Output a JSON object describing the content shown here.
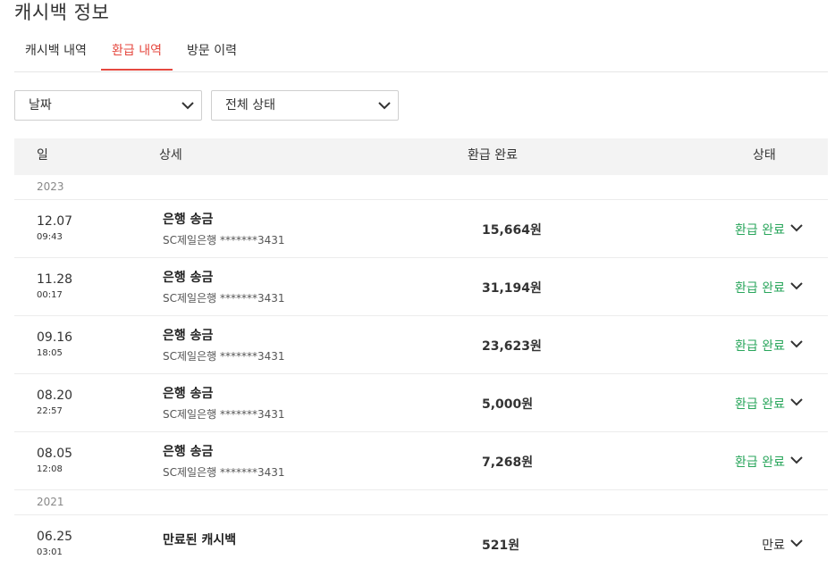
{
  "page_title": "캐시백 정보",
  "tabs": [
    {
      "label": "캐시백 내역",
      "active": false
    },
    {
      "label": "환급 내역",
      "active": true
    },
    {
      "label": "방문 이력",
      "active": false
    }
  ],
  "filters": {
    "date_label": "날짜",
    "status_label": "전체 상태"
  },
  "table": {
    "headers": {
      "day": "일",
      "detail": "상세",
      "refund_done": "환급 완료",
      "status": "상태"
    },
    "groups": [
      {
        "year": "2023",
        "rows": [
          {
            "date": "12.07",
            "time": "09:43",
            "title": "은행 송금",
            "sub": "SC제일은행 *******3431",
            "amount": "15,664원",
            "status": "환급 완료"
          },
          {
            "date": "11.28",
            "time": "00:17",
            "title": "은행 송금",
            "sub": "SC제일은행 *******3431",
            "amount": "31,194원",
            "status": "환급 완료"
          },
          {
            "date": "09.16",
            "time": "18:05",
            "title": "은행 송금",
            "sub": "SC제일은행 *******3431",
            "amount": "23,623원",
            "status": "환급 완료"
          },
          {
            "date": "08.20",
            "time": "22:57",
            "title": "은행 송금",
            "sub": "SC제일은행 *******3431",
            "amount": "5,000원",
            "status": "환급 완료"
          },
          {
            "date": "08.05",
            "time": "12:08",
            "title": "은행 송금",
            "sub": "SC제일은행 *******3431",
            "amount": "7,268원",
            "status": "환급 완료"
          }
        ]
      },
      {
        "year": "2021",
        "rows": [
          {
            "date": "06.25",
            "time": "03:01",
            "title": "만료된 캐시백",
            "sub": "",
            "amount": "521원",
            "status": "만료"
          }
        ]
      }
    ]
  },
  "colors": {
    "accent": "#e5483f",
    "status_complete": "#2aa65c",
    "header_bg": "#f3f3f3"
  },
  "icons": {
    "dropdown": "chevron-down-icon"
  }
}
